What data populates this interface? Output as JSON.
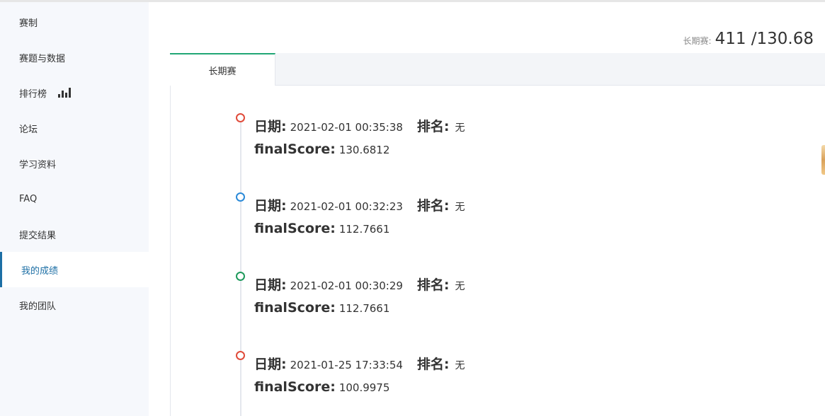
{
  "sidebar": {
    "items": [
      {
        "label": "赛制"
      },
      {
        "label": "赛题与数据"
      },
      {
        "label": "排行榜",
        "icon": "bar-chart-icon"
      },
      {
        "label": "论坛"
      },
      {
        "label": "学习资料"
      },
      {
        "label": "FAQ"
      },
      {
        "label": "提交结果"
      },
      {
        "label": "我的成绩",
        "active": true
      },
      {
        "label": "我的团队"
      }
    ]
  },
  "summary": {
    "label": "长期赛:",
    "value": "411 /130.68"
  },
  "tabs": [
    {
      "label": "长期赛",
      "active": true
    }
  ],
  "timeline": {
    "date_label": "日期:",
    "rank_label": "排名:",
    "score_label": "finalScore:",
    "entries": [
      {
        "date": "2021-02-01 00:35:38",
        "rank": "无",
        "score": "130.6812",
        "dot_color": "#e04b3a"
      },
      {
        "date": "2021-02-01 00:32:23",
        "rank": "无",
        "score": "112.7661",
        "dot_color": "#2b8ad8"
      },
      {
        "date": "2021-02-01 00:30:29",
        "rank": "无",
        "score": "112.7661",
        "dot_color": "#1f9a5c"
      },
      {
        "date": "2021-01-25 17:33:54",
        "rank": "无",
        "score": "100.9975",
        "dot_color": "#e04b3a"
      }
    ]
  },
  "colors": {
    "accent": "#1d6fa5",
    "tab_accent": "#21a675"
  }
}
